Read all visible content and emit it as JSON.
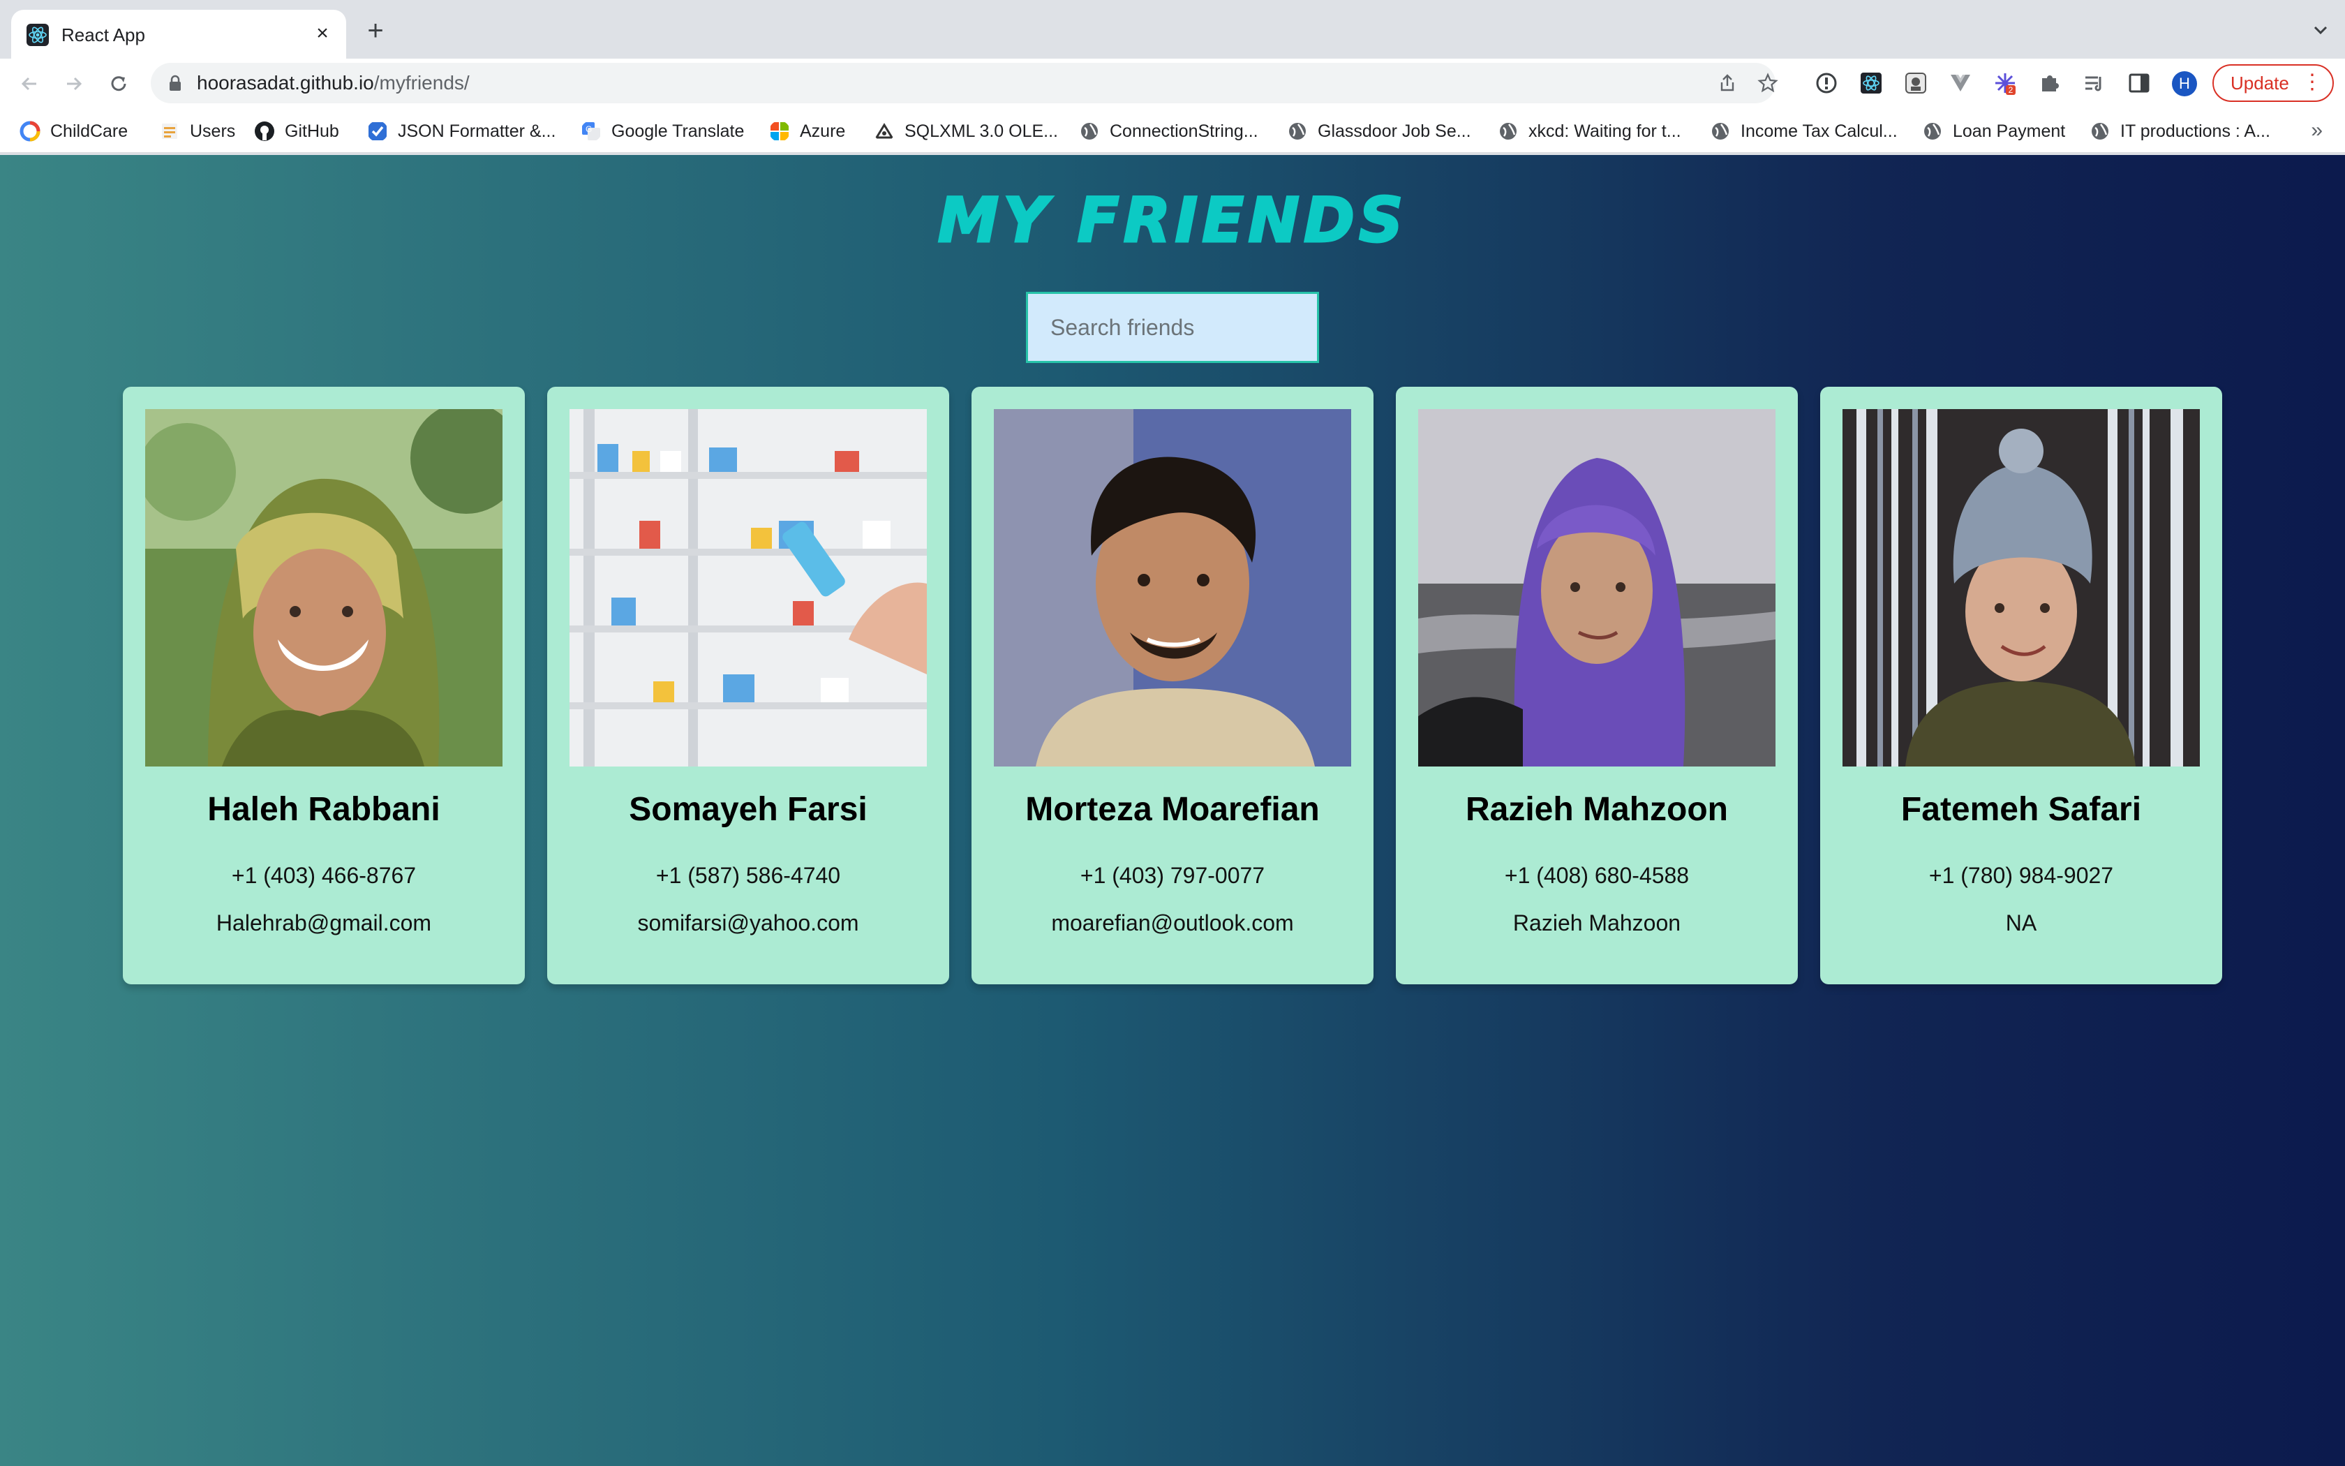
{
  "browser": {
    "tab_title": "React App",
    "new_tab_symbol": "+",
    "close_symbol": "×",
    "url_host": "hoorasadat.github.io",
    "url_path": "/myfriends/",
    "profile_initial": "H",
    "update_label": "Update",
    "extension_badge": "2",
    "bookmarks": [
      {
        "label": "ChildCare",
        "icon": "childcare-icon"
      },
      {
        "label": "Users",
        "icon": "users-icon"
      },
      {
        "label": "GitHub",
        "icon": "github-icon"
      },
      {
        "label": "JSON Formatter &...",
        "icon": "checkbox-icon"
      },
      {
        "label": "Google Translate",
        "icon": "translate-icon"
      },
      {
        "label": "Azure",
        "icon": "microsoft-icon"
      },
      {
        "label": "SQLXML 3.0 OLE...",
        "icon": "sqlxml-icon"
      },
      {
        "label": "ConnectionString...",
        "icon": "globe-icon"
      },
      {
        "label": "Glassdoor Job Se...",
        "icon": "globe-icon"
      },
      {
        "label": "xkcd: Waiting for t...",
        "icon": "globe-icon"
      },
      {
        "label": "Income Tax Calcul...",
        "icon": "globe-icon"
      },
      {
        "label": "Loan Payment",
        "icon": "globe-icon"
      },
      {
        "label": "IT productions : A...",
        "icon": "globe-icon"
      }
    ],
    "bookmarks_more": "»"
  },
  "page": {
    "title": "MY FRIENDS",
    "search_placeholder": "Search friends",
    "colors": {
      "card_bg": "#acebd3",
      "title": "#0ccac4",
      "search_bg": "#d2eafc",
      "gradient_start": "#3a8585",
      "gradient_end": "#0c1a4d"
    }
  },
  "friends": [
    {
      "name": "Haleh Rabbani",
      "phone": "+1 (403) 466-8767",
      "email": "Halehrab@gmail.com",
      "photo": "portrait-photo"
    },
    {
      "name": "Somayeh Farsi",
      "phone": "+1 (587) 586-4740",
      "email": "somifarsi@yahoo.com",
      "photo": "pharmacy-shelf-photo"
    },
    {
      "name": "Morteza Moarefian",
      "phone": "+1 (403) 797-0077",
      "email": "moarefian@outlook.com",
      "photo": "portrait-photo"
    },
    {
      "name": "Razieh Mahzoon",
      "phone": "+1 (408) 680-4588",
      "email": "Razieh Mahzoon",
      "photo": "portrait-photo"
    },
    {
      "name": "Fatemeh Safari",
      "phone": "+1 (780) 984-9027",
      "email": "NA",
      "photo": "portrait-photo"
    }
  ]
}
